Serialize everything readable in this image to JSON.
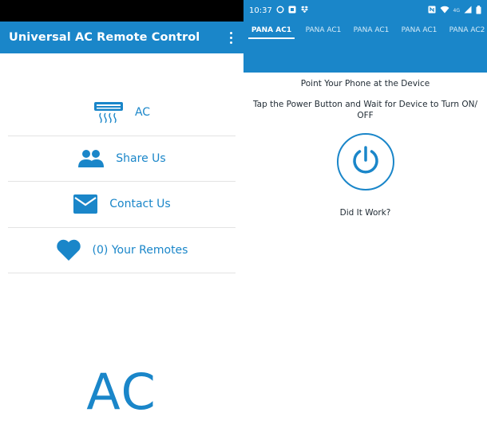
{
  "left": {
    "app_title": "Universal AC Remote Control",
    "overflow_menu_icon": "more-vert-icon",
    "menu_items": [
      {
        "label": "AC",
        "icon": "air-conditioner-icon"
      },
      {
        "label": "Share Us",
        "icon": "people-icon"
      },
      {
        "label": "Contact Us",
        "icon": "mail-icon"
      },
      {
        "label": "(0) Your Remotes",
        "icon": "heart-icon"
      }
    ],
    "large_text": "AC"
  },
  "right": {
    "status_bar": {
      "time": "10:37",
      "left_icons": [
        "circle-icon",
        "app-notification-icon",
        "dropbox-icon"
      ],
      "right_icons": [
        "nfc-icon",
        "wifi-icon",
        "signal-icon",
        "battery-icon"
      ],
      "network_label": "4G"
    },
    "tabs": [
      "PANA AC1",
      "PANA AC1",
      "PANA AC1",
      "PANA AC1",
      "PANA AC2"
    ],
    "active_tab_index": 0,
    "instruction_1": "Point Your Phone at the Device",
    "instruction_2": "Tap the Power Button and Wait for Device to Turn ON/ OFF",
    "power_icon": "power-icon",
    "did_it_work": "Did It Work?"
  },
  "colors": {
    "primary": "#1a86c9",
    "text_dark": "#1f2a33",
    "divider": "#e3e3e3",
    "status_black": "#000000"
  }
}
